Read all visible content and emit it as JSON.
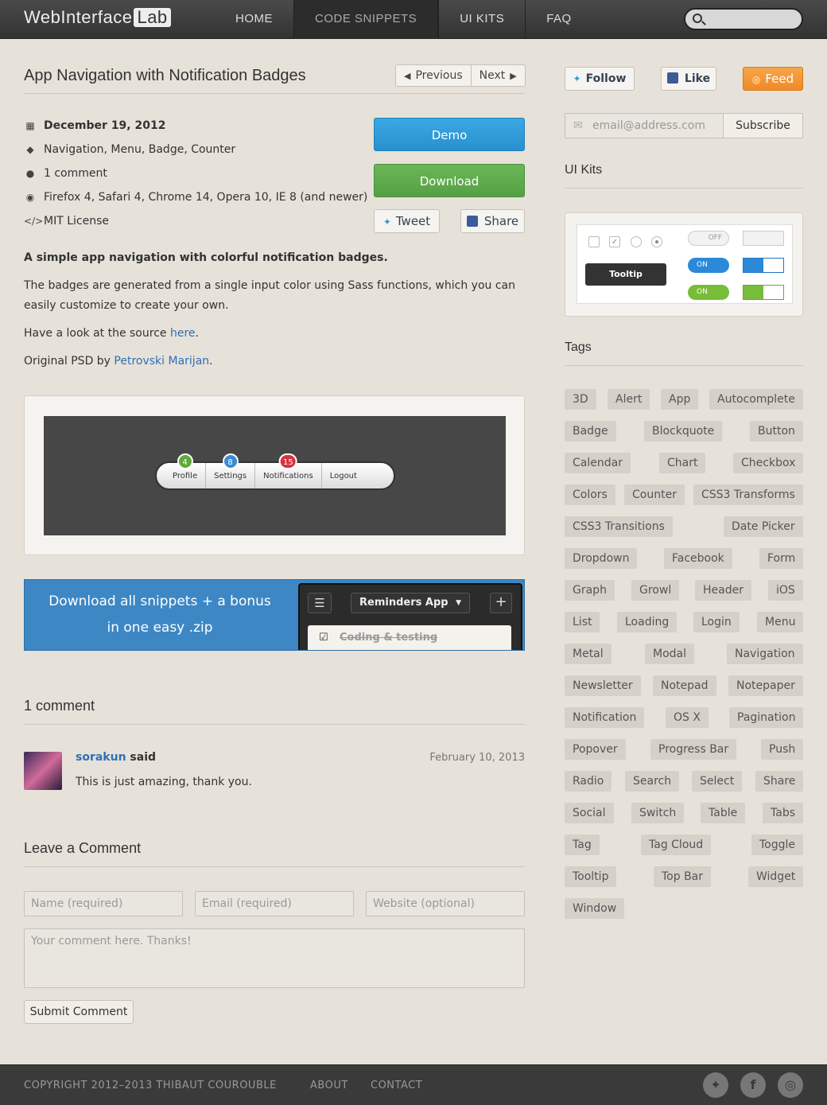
{
  "site": {
    "logo_main": "WebInterface",
    "logo_badge": "Lab"
  },
  "nav": {
    "items": [
      {
        "label": "HOME"
      },
      {
        "label": "CODE SNIPPETS"
      },
      {
        "label": "UI KITS"
      },
      {
        "label": "FAQ"
      }
    ]
  },
  "article": {
    "title": "App Navigation with Notification Badges",
    "prev_label": "Previous",
    "next_label": "Next",
    "meta": {
      "date": "December 19, 2012",
      "tags": "Navigation, Menu, Badge, Counter",
      "comments": "1 comment",
      "browsers": "Firefox 4, Safari 4, Chrome 14, Opera 10, IE 8 (and newer)",
      "license": "MIT License"
    },
    "buttons": {
      "demo": "Demo",
      "download": "Download",
      "tweet": "Tweet",
      "share": "Share"
    },
    "intro": "A simple app navigation with colorful notification badges.",
    "para1": "The badges are generated from a single input color using Sass functions, which you can easily customize to create your own.",
    "para2_prefix": "Have a look at the source ",
    "para2_link": "here",
    "para2_suffix": ".",
    "para3_prefix": "Original PSD by ",
    "para3_link": "Petrovski Marijan",
    "para3_suffix": "."
  },
  "demo_nav": {
    "items": [
      {
        "label": "Profile",
        "badge": "4",
        "color": "#5fa83a"
      },
      {
        "label": "Settings",
        "badge": "8",
        "color": "#3d8ad6"
      },
      {
        "label": "Notifications",
        "badge": "15",
        "color": "#d9323e"
      },
      {
        "label": "Logout",
        "badge": "",
        "color": ""
      }
    ]
  },
  "promo": {
    "line1": "Download all snippets + a bonus",
    "line2": "in one easy .zip",
    "app_title": "Reminders App",
    "item": "Coding & testing"
  },
  "comments": {
    "heading": "1 comment",
    "author": "sorakun",
    "said": "said",
    "date": "February 10, 2013",
    "text": "This is just amazing, thank you."
  },
  "form": {
    "heading": "Leave a Comment",
    "name_placeholder": "Name (required)",
    "email_placeholder": "Email (required)",
    "website_placeholder": "Website (optional)",
    "comment_placeholder": "Your comment here. Thanks!",
    "submit": "Submit Comment"
  },
  "sidebar": {
    "follow": "Follow",
    "like": "Like",
    "feed": "Feed",
    "email_placeholder": "email@address.com",
    "subscribe": "Subscribe",
    "uikits_heading": "UI Kits",
    "uikit_off": "OFF",
    "uikit_on": "ON",
    "uikit_tooltip": "Tooltip",
    "tags_heading": "Tags",
    "tags": [
      "3D",
      "Alert",
      "App",
      "Autocomplete",
      "Badge",
      "Blockquote",
      "Button",
      "Calendar",
      "Chart",
      "Checkbox",
      "Colors",
      "Counter",
      "CSS3 Transforms",
      "CSS3 Transitions",
      "Date Picker",
      "Dropdown",
      "Facebook",
      "Form",
      "Graph",
      "Growl",
      "Header",
      "iOS",
      "List",
      "Loading",
      "Login",
      "Menu",
      "Metal",
      "Modal",
      "Navigation",
      "Newsletter",
      "Notepad",
      "Notepaper",
      "Notification",
      "OS X",
      "Pagination",
      "Popover",
      "Progress Bar",
      "Push",
      "Radio",
      "Search",
      "Select",
      "Share",
      "Social",
      "Switch",
      "Table",
      "Tabs",
      "Tag",
      "Tag Cloud",
      "Toggle",
      "Tooltip",
      "Top Bar",
      "Widget",
      "Window"
    ]
  },
  "footer": {
    "copyright": "COPYRIGHT 2012–2013 THIBAUT COUROUBLE",
    "about": "ABOUT",
    "contact": "CONTACT"
  }
}
